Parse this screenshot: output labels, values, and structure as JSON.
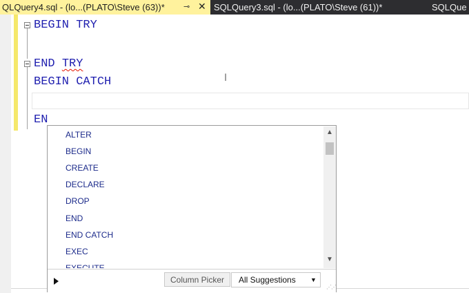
{
  "tabs": [
    {
      "label": "QLQuery4.sql - (lo...(PLATO\\Steve (63))*",
      "pin": "⊸",
      "close": "✕"
    },
    {
      "label": "SQLQuery3.sql - (lo...(PLATO\\Steve (61))*"
    },
    {
      "label": "SQLQue"
    }
  ],
  "editor": {
    "lines": {
      "l1": "BEGIN TRY",
      "l3_a": "END ",
      "l3_b": "TRY",
      "l4": "BEGIN CATCH",
      "l6": "EN"
    }
  },
  "autocomplete": {
    "items": [
      "ALTER",
      "BEGIN",
      "CREATE",
      "DECLARE",
      "DROP",
      "END",
      "END CATCH",
      "EXEC",
      "EXECUTE"
    ],
    "column_picker_label": "Column Picker",
    "all_suggestions_label": "All Suggestions",
    "dropdown_glyph": "▼",
    "scroll_up_glyph": "▲",
    "scroll_down_glyph": "▼"
  },
  "colors": {
    "keyword": "#1f1faf",
    "active_tab": "#fff29d",
    "tab_strip": "#2d2d30",
    "change_bar": "#f5e86b"
  },
  "icons": {
    "pin": "pin-icon",
    "close": "close-icon",
    "fold": "fold-collapse-icon",
    "play": "play-icon",
    "dropdown": "chevron-down-icon",
    "grip": "resize-grip-icon"
  }
}
